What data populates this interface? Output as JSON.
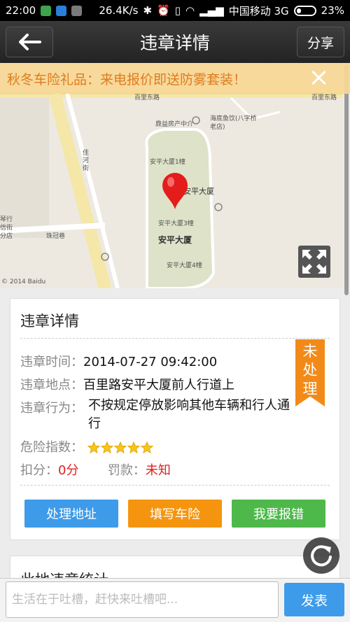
{
  "status_bar": {
    "time": "22:00",
    "speed": "26.4K/s",
    "carrier": "中国移动 3G",
    "battery": "23%"
  },
  "header": {
    "title": "违章详情",
    "share_label": "分享"
  },
  "banner": {
    "text": "秋冬车险礼品：来电报价即送防雾套装！"
  },
  "map": {
    "labels": {
      "road_top_left": "百里东路",
      "road_top_right": "百里东路",
      "agency": "鼎益房产中介",
      "restaurant": "海底鱼饮(八字桥老店)",
      "street": "佳河街",
      "building_top": "安平大厦1幢",
      "building_marker": "安平大厦",
      "building_mid": "安平大厦3幢",
      "building_main": "安平大厦",
      "building_bottom": "安平大厦4幢",
      "alley": "珠冠巷",
      "branch": "琴行信街分店",
      "copyright": "© 2014 Baidu"
    }
  },
  "detail": {
    "title": "违章详情",
    "status": "未处理",
    "time_label": "违章时间：",
    "time_value": "2014-07-27 09:42:00",
    "place_label": "违章地点：",
    "place_value": "百里路安平大厦前人行道上",
    "act_label": "违章行为：",
    "act_value": "不按规定停放影响其他车辆和行人通行",
    "risk_label": "危险指数：",
    "risk_rating": 5,
    "risk_max": 5,
    "points_label": "扣分：",
    "points_value": "0分",
    "fine_label": "罚款：",
    "fine_value": "未知",
    "buttons": {
      "address": "处理地址",
      "insurance": "填写车险",
      "report": "我要报错"
    }
  },
  "stats": {
    "title": "此地违章统计"
  },
  "comment": {
    "placeholder": "生活在于吐槽，赶快来吐槽吧...",
    "send_label": "发表"
  },
  "colors": {
    "accent_blue": "#3d9be9",
    "accent_orange": "#f5950f",
    "accent_green": "#4eb84b",
    "status_orange": "#f28a1a",
    "alert_red": "#e02020"
  },
  "icons": {
    "back": "arrow-left-icon",
    "close": "close-icon",
    "pin": "map-pin-icon",
    "expand": "expand-icon",
    "refresh": "refresh-icon",
    "star": "star-icon"
  }
}
